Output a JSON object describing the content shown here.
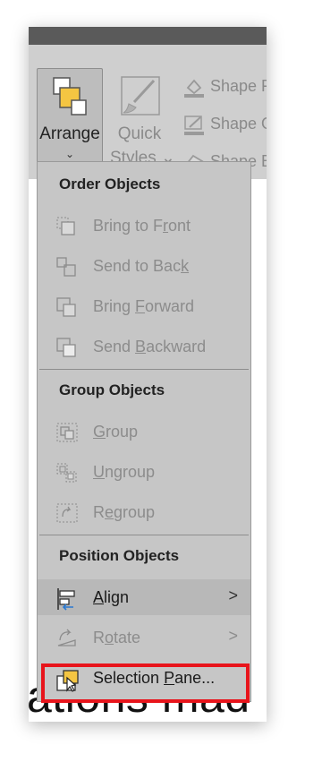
{
  "ribbon": {
    "arrange": {
      "label": "Arrange",
      "chevron": "⌄"
    },
    "quick_styles": {
      "line1": "Quick",
      "line2": "Styles ⌄"
    },
    "shape_fill": "Shape F",
    "shape_outline": "Shape O",
    "shape_effects": "Shape E"
  },
  "background_text": "ations mad",
  "menu": {
    "order_header": "Order Objects",
    "order_items": [
      {
        "icon": "bring-to-front-icon",
        "pre": "Bring to F",
        "u": "r",
        "post": "ont",
        "enabled": false
      },
      {
        "icon": "send-to-back-icon",
        "pre": "Send to Bac",
        "u": "k",
        "post": "",
        "enabled": false
      },
      {
        "icon": "bring-forward-icon",
        "pre": "Bring ",
        "u": "F",
        "post": "orward",
        "enabled": false
      },
      {
        "icon": "send-backward-icon",
        "pre": "Send ",
        "u": "B",
        "post": "ackward",
        "enabled": false
      }
    ],
    "group_header": "Group Objects",
    "group_items": [
      {
        "icon": "group-icon",
        "pre": "",
        "u": "G",
        "post": "roup",
        "enabled": false
      },
      {
        "icon": "ungroup-icon",
        "pre": "",
        "u": "U",
        "post": "ngroup",
        "enabled": false
      },
      {
        "icon": "regroup-icon",
        "pre": "R",
        "u": "e",
        "post": "group",
        "enabled": false
      }
    ],
    "position_header": "Position Objects",
    "align": {
      "pre": "",
      "u": "A",
      "post": "lign",
      "arrow": ">",
      "enabled": true
    },
    "rotate": {
      "pre": "R",
      "u": "o",
      "post": "tate",
      "arrow": ">",
      "enabled": false
    },
    "selection_pane": {
      "pre": "Selection ",
      "u": "P",
      "post": "ane...",
      "enabled": true
    }
  },
  "colors": {
    "highlight": "#e8141b",
    "arrange_icon_fill": "#f4c542"
  }
}
